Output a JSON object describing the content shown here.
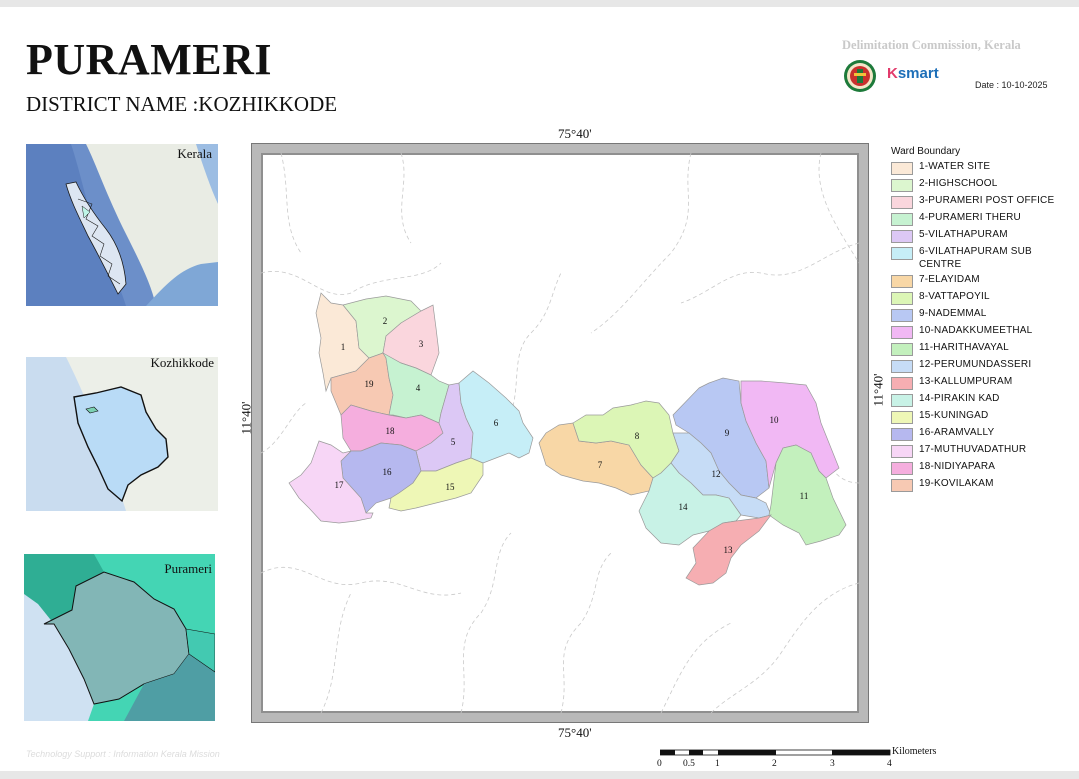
{
  "header": {
    "title": "PURAMERI",
    "district": "DISTRICT NAME :KOZHIKKODE",
    "commission": "Delimitation Commission, Kerala",
    "ksmart_k": "K",
    "ksmart_rest": "smart",
    "date": "Date : 10-10-2025"
  },
  "insets": {
    "kerala": "Kerala",
    "kozhikode": "Kozhikkode",
    "purameri": "Purameri"
  },
  "coordinates": {
    "top": "75°40'",
    "bottom": "75°40'",
    "left": "11°40'",
    "right": "11°40'"
  },
  "legend": {
    "title": "Ward Boundary",
    "items": [
      {
        "num": "1",
        "label": "1-WATER SITE",
        "color": "#fbe9d7"
      },
      {
        "num": "2",
        "label": "2-HIGHSCHOOL",
        "color": "#dcf6cf"
      },
      {
        "num": "3",
        "label": "3-PURAMERI POST OFFICE",
        "color": "#fad6dd"
      },
      {
        "num": "4",
        "label": "4-PURAMERI THERU",
        "color": "#c6f2d1"
      },
      {
        "num": "5",
        "label": "5-VILATHAPURAM",
        "color": "#dcc8f5"
      },
      {
        "num": "6",
        "label": "6-VILATHAPURAM SUB CENTRE",
        "color": "#c6eef7"
      },
      {
        "num": "7",
        "label": "7-ELAYIDAM",
        "color": "#f8d7a6"
      },
      {
        "num": "8",
        "label": "8-VATTAPOYIL",
        "color": "#dcf6b6"
      },
      {
        "num": "9",
        "label": "9-NADEMMAL",
        "color": "#b8c8f3"
      },
      {
        "num": "10",
        "label": "10-NADAKKUMEETHAL",
        "color": "#f1b8f4"
      },
      {
        "num": "11",
        "label": "11-HARITHAVAYAL",
        "color": "#c3f0bd"
      },
      {
        "num": "12",
        "label": "12-PERUMUNDASSERI",
        "color": "#c6dcf6"
      },
      {
        "num": "13",
        "label": "13-KALLUMPURAM",
        "color": "#f6aeb2"
      },
      {
        "num": "14",
        "label": "14-PIRAKIN KAD",
        "color": "#c8f2e6"
      },
      {
        "num": "15",
        "label": "15-KUNINGAD",
        "color": "#eef7b6"
      },
      {
        "num": "16",
        "label": "16-ARAMVALLY",
        "color": "#b6b8ef"
      },
      {
        "num": "17",
        "label": "17-MUTHUVADATHUR",
        "color": "#f7d6f6"
      },
      {
        "num": "18",
        "label": "18-NIDIYAPARA",
        "color": "#f5aede"
      },
      {
        "num": "19",
        "label": "19-KOVILAKAM",
        "color": "#f7c9b3"
      }
    ]
  },
  "scale": {
    "unit": "Kilometers",
    "ticks": [
      "0",
      "0.5",
      "1",
      "2",
      "3",
      "4"
    ]
  },
  "footer": {
    "tech_support": "Technology Support : Information Kerala Mission"
  }
}
